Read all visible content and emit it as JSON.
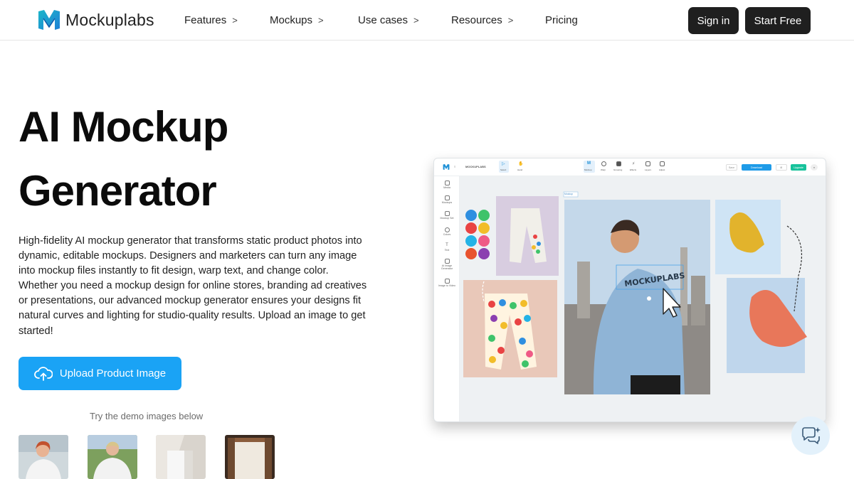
{
  "brand": {
    "name": "Mockuplabs",
    "accent": "#1aa3f5",
    "dark": "#1f1f1f"
  },
  "nav": {
    "features": "Features",
    "mockups": "Mockups",
    "use_cases": "Use cases",
    "resources": "Resources",
    "pricing": "Pricing",
    "chevron": ">",
    "sign_in": "Sign in",
    "start_free": "Start Free"
  },
  "hero": {
    "title_line1": "AI Mockup",
    "title_line2": "Generator",
    "description": "High-fidelity AI mockup generator that transforms static product photos into dynamic, editable mockups. Designers and marketers can turn any image into mockup files instantly to fit design, warp text, and change color. Whether you need a mockup design for online stores, branding ad creatives or presentations, our advanced mockup generator ensures your designs fit natural curves and lighting for studio-quality results. Upload an image to get started!",
    "upload_label": "Upload Product Image",
    "demo_caption": "Try the demo images below"
  },
  "app_preview": {
    "project_name": "MOCKUPLABS",
    "sidebar": [
      "Media",
      "Mockups",
      "Mockup Set",
      "Colors",
      "Text",
      "AI Image Generator",
      "Image to Video"
    ],
    "toolbar": [
      "Mockup",
      "Warp",
      "Grouping",
      "Effects",
      "Layers",
      "Adjust"
    ],
    "tools": [
      "Select",
      "Hand"
    ],
    "save_label": "Save",
    "download_label": "Download",
    "upgrade_label": "Upgrade",
    "tshirt_text": "MOCKUPLABS",
    "selection_tag": "Mockup"
  },
  "icons": [
    "logo-icon",
    "chevron-right-icon",
    "upload-cloud-icon",
    "cursor-icon",
    "chat-sparkle-icon"
  ]
}
